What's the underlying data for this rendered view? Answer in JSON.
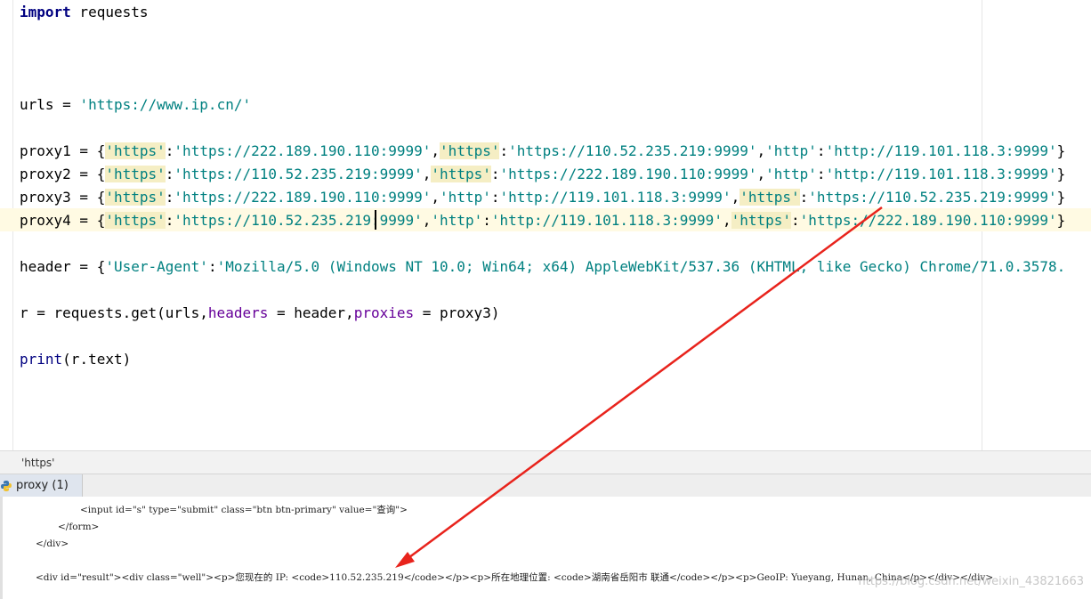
{
  "editor": {
    "lines": [
      "import requests",
      "urls = 'https://www.ip.cn/'",
      "proxy1 = {'https':'https://222.189.190.110:9999','https':'https://110.52.235.219:9999','http':'http://119.101.118.3:9999'}",
      "proxy2 = {'https':'https://110.52.235.219:9999','https':'https://222.189.190.110:9999','http':'http://119.101.118.3:9999'}",
      "proxy3 = {'https':'https://222.189.190.110:9999','http':'http://119.101.118.3:9999','https':'https://110.52.235.219:9999'}",
      "proxy4 = {'https':'https://110.52.235.219:9999','http':'http://119.101.118.3:9999','https':'https://222.189.190.110:9999'}",
      "header = {'User-Agent':'Mozilla/5.0 (Windows NT 10.0; Win64; x64) AppleWebKit/537.36 (KHTML, like Gecko) Chrome/71.0.3578.",
      "r = requests.get(urls,headers = header,proxies = proxy3)",
      "print(r.text)"
    ],
    "tokens": {
      "import_kw": "import",
      "requests_mod": " requests",
      "urls_var": "urls = ",
      "urls_val": "'https://www.ip.cn/'",
      "proxy_names": [
        "proxy1 = ",
        "proxy2 = ",
        "proxy3 = ",
        "proxy4 = "
      ],
      "key_https": "'https'",
      "key_http": "'http'",
      "ip_222": "'https://222.189.190.110:9999'",
      "ip_110": "'https://110.52.235.219:9999'",
      "ip_119": "'http://119.101.118.3:9999'",
      "header_var": "header = ",
      "ua_key": "'User-Agent'",
      "ua_val": "'Mozilla/5.0 (Windows NT 10.0; Win64; x64) AppleWebKit/537.36 (KHTML, like Gecko) Chrome/71.0.3578.",
      "r_assign": "r = requests.get(urls,",
      "headers_param": "headers",
      "eq_header": " = header,",
      "proxies_param": "proxies",
      "eq_proxy3": " = proxy3)",
      "print_fn": "print",
      "print_arg": "(r.text)"
    }
  },
  "breadcrumb": "'https'",
  "run_tab": {
    "label": "proxy (1)",
    "icon": "python-icon"
  },
  "console": {
    "lines": [
      "<input id=\"s\" type=\"submit\" class=\"btn btn-primary\" value=\"查询\">",
      "</form>",
      "</div>",
      "<div id=\"result\"><div class=\"well\"><p>您现在的 IP: <code>110.52.235.219</code></p><p>所在地理位置: <code>湖南省岳阳市 联通</code></p><p>GeoIP: Yueyang, Hunan, China</p></div></div>"
    ]
  },
  "watermark": "https://blog.csdn.net/weixin_43821663",
  "colors": {
    "annotation_arrow": "#e8231c",
    "current_line": "#fffae3",
    "string_teal": "#008080",
    "keyword_navy": "#000080"
  }
}
